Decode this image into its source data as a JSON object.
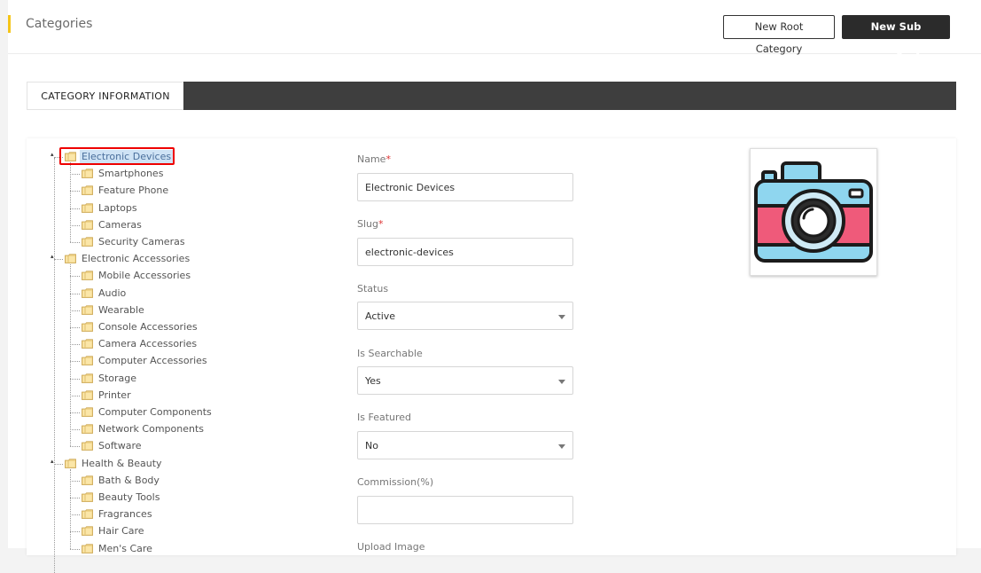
{
  "header": {
    "title": "Categories",
    "new_root_label": "New Root Category",
    "new_sub_label": "New Sub Category"
  },
  "tabs": [
    {
      "label": "CATEGORY INFORMATION",
      "active": true
    }
  ],
  "tree": {
    "groups": [
      {
        "label": "Electronic Devices",
        "selected": true,
        "children": [
          "Smartphones",
          "Feature Phone",
          "Laptops",
          "Cameras",
          "Security Cameras"
        ]
      },
      {
        "label": "Electronic Accessories",
        "selected": false,
        "children": [
          "Mobile Accessories",
          "Audio",
          "Wearable",
          "Console Accessories",
          "Camera Accessories",
          "Computer Accessories",
          "Storage",
          "Printer",
          "Computer Components",
          "Network Components",
          "Software"
        ]
      },
      {
        "label": "Health & Beauty",
        "selected": false,
        "children": [
          "Bath & Body",
          "Beauty Tools",
          "Fragrances",
          "Hair Care",
          "Men's Care"
        ]
      }
    ]
  },
  "form": {
    "name_label": "Name",
    "name_value": "Electronic Devices",
    "slug_label": "Slug",
    "slug_value": "electronic-devices",
    "required_mark": "*",
    "status_label": "Status",
    "status_value": "Active",
    "searchable_label": "Is Searchable",
    "searchable_value": "Yes",
    "featured_label": "Is Featured",
    "featured_value": "No",
    "commission_label": "Commission(%)",
    "commission_value": "",
    "upload_label": "Upload Image"
  },
  "preview": {
    "icon": "camera-icon"
  },
  "colors": {
    "accent": "#f5c518",
    "tabbar": "#3e3e3e",
    "dark_button": "#2b2b2b",
    "selection": "#cfe3f5",
    "highlight": "#ee0000"
  }
}
